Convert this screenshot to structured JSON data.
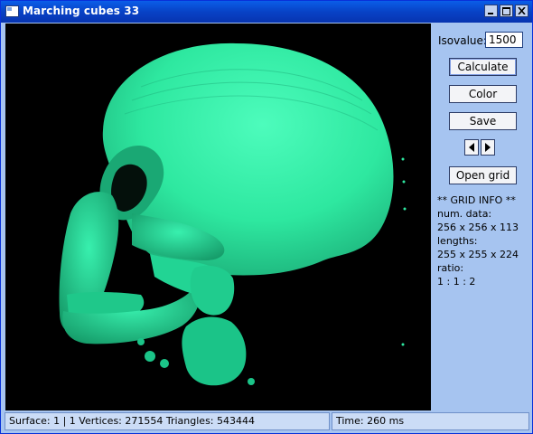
{
  "window": {
    "title": "Marching cubes 33"
  },
  "panel": {
    "isovalue_label": "Isovalue:",
    "isovalue": "1500",
    "calculate_label": "Calculate",
    "color_label": "Color",
    "save_label": "Save",
    "open_grid_label": "Open grid",
    "grid_info": {
      "header": "** GRID  INFO **",
      "num_data_label": "num. data:",
      "num_data": "256 x 256 x 113",
      "lengths_label": "lengths:",
      "lengths": "255 x 255 x 224",
      "ratio_label": "ratio:",
      "ratio": "1 : 1 : 2"
    }
  },
  "status": {
    "surface": "Surface: 1 | 1   Vertices: 271554   Triangles: 543444",
    "time": "Time: 260 ms"
  },
  "render": {
    "background": "#000000",
    "surface_color": "#2ee8a0"
  }
}
